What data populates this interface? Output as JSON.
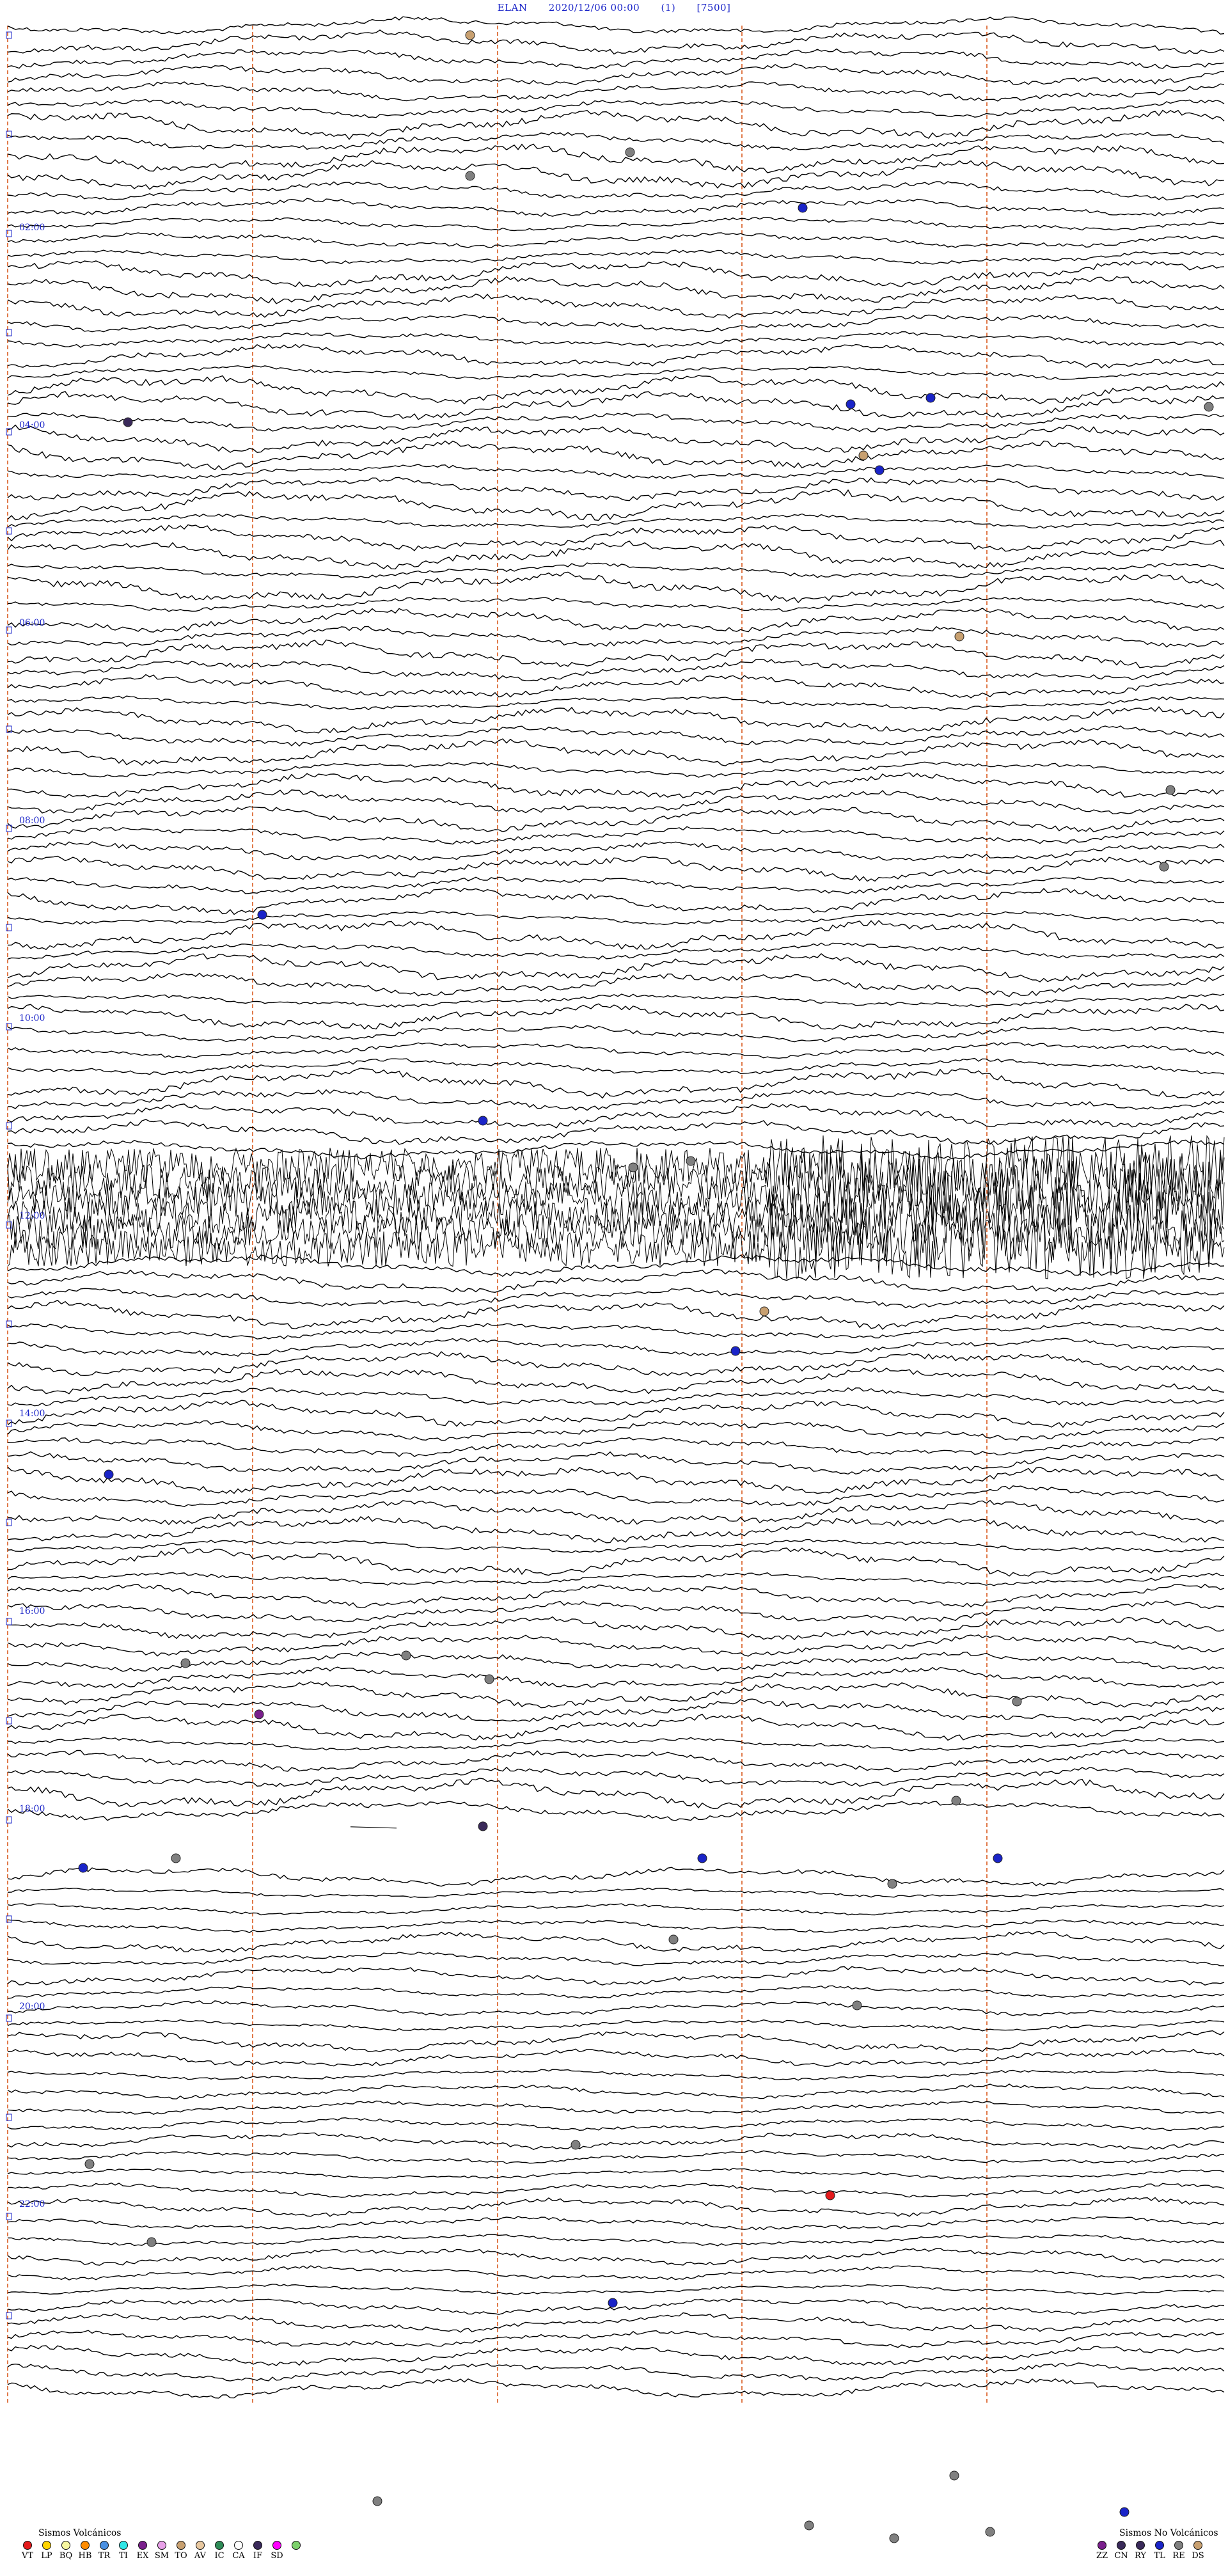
{
  "header": {
    "station": "ELAN",
    "datetime": "2020/12/06 00:00",
    "channel": "(1)",
    "scale": "[7500]"
  },
  "time_labels": [
    "02:00",
    "04:00",
    "06:00",
    "08:00",
    "10:00",
    "12:00",
    "14:00",
    "16:00",
    "18:00",
    "20:00",
    "22:00"
  ],
  "legend_volcanic": {
    "title": "Sismos Volcánicos",
    "items": [
      {
        "code": "VT",
        "color": "#e41a1c"
      },
      {
        "code": "LP",
        "color": "#ffd400"
      },
      {
        "code": "BQ",
        "color": "#f7f7a0"
      },
      {
        "code": "HB",
        "color": "#ff8c00"
      },
      {
        "code": "TR",
        "color": "#4a90e2"
      },
      {
        "code": "TI",
        "color": "#2ee6e6"
      },
      {
        "code": "EX",
        "color": "#7a1f8c"
      },
      {
        "code": "SM",
        "color": "#e8a0e8"
      },
      {
        "code": "TO",
        "color": "#c8a070"
      },
      {
        "code": "AV",
        "color": "#e8c8a0"
      },
      {
        "code": "IC",
        "color": "#2e8b57"
      },
      {
        "code": "CA",
        "color": "#ffffff"
      },
      {
        "code": "IF",
        "color": "#3a2a5a"
      },
      {
        "code": "SD",
        "color": "#ff00ff"
      },
      {
        "code": "",
        "color": "#7cd16b"
      }
    ]
  },
  "legend_nonvolcanic": {
    "title": "Sismos No Volcánicos",
    "items": [
      {
        "code": "ZZ",
        "color": "#7a1f8c"
      },
      {
        "code": "CN",
        "color": "#3a2a5a"
      },
      {
        "code": "RY",
        "color": "#3a2a5a"
      },
      {
        "code": "TL",
        "color": "#1a24c8"
      },
      {
        "code": "RE",
        "color": "#808080"
      },
      {
        "code": "DS",
        "color": "#c8a070"
      }
    ]
  },
  "colors": {
    "trace": "#000000",
    "marker_line": "#e07a4a",
    "header_text": "#1a24c8",
    "label_text": "#1a24c8"
  }
}
